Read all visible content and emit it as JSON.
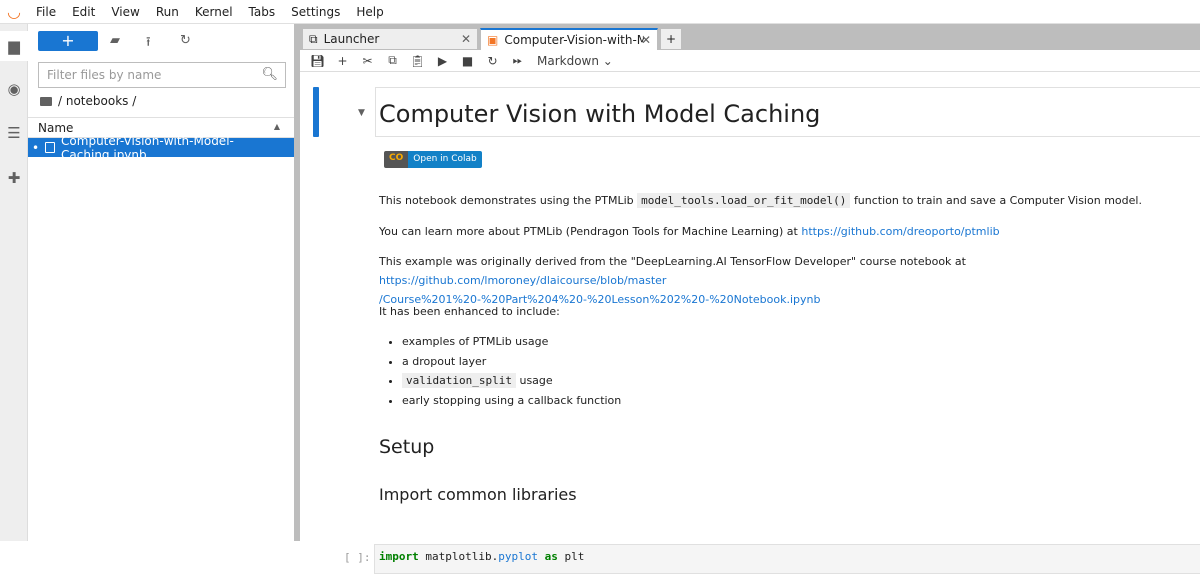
{
  "menu": [
    "File",
    "Edit",
    "View",
    "Run",
    "Kernel",
    "Tabs",
    "Settings",
    "Help"
  ],
  "filebrowser": {
    "new_label": "+",
    "filter_placeholder": "Filter files by name",
    "breadcrumb": "/ notebooks /",
    "column_name": "Name",
    "files": [
      "Computer-Vision-with-Model-Caching.ipynb"
    ]
  },
  "tabs": [
    {
      "label": "Launcher"
    },
    {
      "label": "Computer-Vision-with-Mode"
    }
  ],
  "toolbar": {
    "cell_type": "Markdown"
  },
  "notebook": {
    "title": "Computer Vision with Model Caching",
    "colab_co": "CO",
    "colab_label": "Open in Colab",
    "p1_pre": "This notebook demonstrates using the PTMLib",
    "p1_code": "model_tools.load_or_fit_model()",
    "p1_post": "function to train and save a Computer Vision model.",
    "p2_pre": "You can learn more about PTMLib (Pendragon Tools for Machine Learning) at",
    "p2_link": "https://github.com/dreoporto/ptmlib",
    "p3_pre": "This example was originally derived from the \"DeepLearning.AI TensorFlow Developer\" course notebook at",
    "p3_link1": "https://github.com/lmoroney/dlaicourse/blob/master",
    "p3_link2": "/Course%201%20-%20Part%204%20-%20Lesson%202%20-%20Notebook.ipynb",
    "p4": "It has been enhanced to include:",
    "bullets": [
      "examples of PTMLib usage",
      "a dropout layer",
      "validation_split",
      "usage",
      "early stopping using a callback function"
    ],
    "h2": "Setup",
    "h3": "Import common libraries",
    "prompt": "[ ]:",
    "code": {
      "kw1": "import",
      "mod": "matplotlib.",
      "sub": "pyplot",
      "kw2": "as",
      "alias": "plt"
    }
  },
  "colors": {
    "accent": "#1976d2",
    "logo": "#f37626"
  }
}
